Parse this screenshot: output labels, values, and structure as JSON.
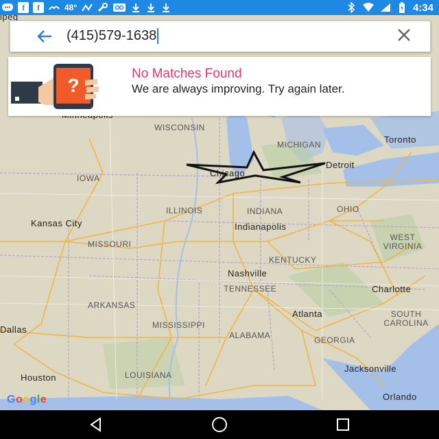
{
  "status_bar": {
    "temperature": "48°",
    "time": "4:34",
    "left_icons": [
      "chat-icon",
      "facebook-icon",
      "facebook-icon",
      "weather-icon",
      "temperature",
      "activity-icon",
      "wrench-icon",
      "voicemail-icon",
      "download-icon",
      "download-icon",
      "download-icon"
    ],
    "right_icons": [
      "bluetooth-icon",
      "signal-icon",
      "battery-icon"
    ],
    "colors": {
      "background": "#1e88e5",
      "foreground": "#ffffff"
    }
  },
  "search": {
    "query": "(415)579-1638",
    "back_icon": "arrow-left-icon",
    "clear_icon": "close-icon"
  },
  "result_card": {
    "title": "No Matches Found",
    "message": "We are always improving. Try again later.",
    "illustration": "phone-question-icon",
    "title_color": "#e8336b"
  },
  "map": {
    "state_labels": [
      "WISCONSIN",
      "MICHIGAN",
      "IOWA",
      "ILLINOIS",
      "INDIANA",
      "OHIO",
      "MISSOURI",
      "KENTUCKY",
      "WEST VIRGINIA",
      "TENNESSEE",
      "ARKANSAS",
      "MISSISSIPPI",
      "ALABAMA",
      "GEORGIA",
      "SOUTH CAROLINA",
      "LOUISIANA"
    ],
    "city_labels": [
      "Minneapolis",
      "Toronto",
      "Chicago",
      "Detroit",
      "Kansas City",
      "Indianapolis",
      "Nashville",
      "Charlotte",
      "Atlanta",
      "Dallas",
      "Houston",
      "Jacksonville",
      "Orlando",
      "ipeg"
    ],
    "marker_icon": "star-outline-icon",
    "attribution": "Google"
  },
  "nav_bar": {
    "buttons": [
      "back-icon",
      "home-icon",
      "recents-icon"
    ]
  }
}
